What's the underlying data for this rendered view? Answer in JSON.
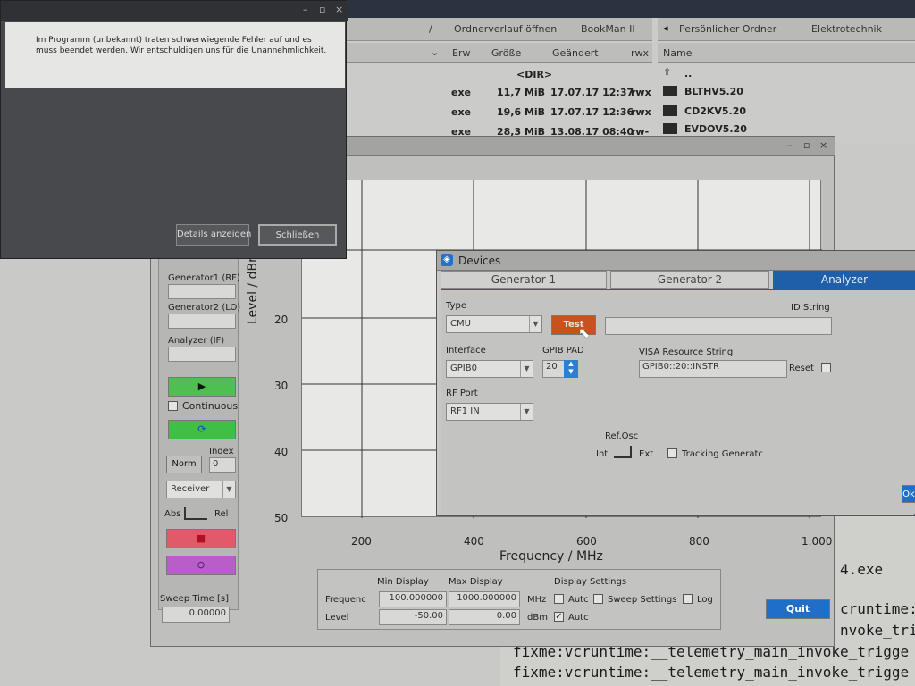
{
  "terminal": {
    "lines": [
      "4.exe",
      "cruntime:",
      "nvoke_trigge",
      "fixme:vcruntime:__telemetry_main_invoke_trigge",
      "fixme:vcruntime:__telemetry_main_invoke_trigge"
    ]
  },
  "file_manager": {
    "breadcrumb": [
      "Ordnerverlauf öffnen",
      "BookMan II"
    ],
    "right_breadcrumb": [
      "Persönlicher Ordner",
      "Elektrotechnik"
    ],
    "columns": [
      "Erw",
      "Größe",
      "Geändert",
      "rwx"
    ],
    "right_column": "Name",
    "rows": [
      {
        "ext": "",
        "size": "<DIR>",
        "date": "",
        "perm": ""
      },
      {
        "ext": "exe",
        "size": "11,7 MiB",
        "date": "17.07.17 12:37",
        "perm": "rwx"
      },
      {
        "ext": "exe",
        "size": "19,6 MiB",
        "date": "17.07.17 12:36",
        "perm": "rwx"
      },
      {
        "ext": "exe",
        "size": "28,3 MiB",
        "date": "13.08.17 08:40",
        "perm": "rw-"
      }
    ],
    "folders": [
      "..",
      "BLTHV5.20",
      "CD2KV5.20",
      "EVDOV5.20"
    ]
  },
  "error_dialog": {
    "message": "Im Programm (unbekannt) traten schwerwiegende Fehler auf und es muss beendet werden. Wir entschuldigen uns für die Unannehmlichkeit.",
    "details_button": "Details anzeigen",
    "close_button": "Schließen"
  },
  "main_app": {
    "left_panel": {
      "gen1_label": "Generator1 (RF)",
      "gen2_label": "Generator2 (LO)",
      "analyzer_label": "Analyzer (IF)",
      "continuous_label": "Continuous",
      "index_label": "Index",
      "index_value": "0",
      "norm_button": "Norm",
      "receiver_select": "Receiver",
      "abs_label": "Abs",
      "rel_label": "Rel",
      "sweep_time_label": "Sweep Time [s]",
      "sweep_time_value": "0.00000"
    },
    "display": {
      "min_label": "Min Display",
      "max_label": "Max Display",
      "settings_label": "Display Settings",
      "frequency_label": "Frequenc",
      "level_label": "Level",
      "freq_min": "100.000000",
      "freq_max": "1000.000000",
      "freq_unit": "MHz",
      "level_min": "-50.00",
      "level_max": "0.00",
      "level_unit": "dBm",
      "auto1": "Autc",
      "sweep_settings": "Sweep Settings",
      "log": "Log",
      "auto2": "Autc"
    },
    "quit_button": "Quit"
  },
  "chart_data": {
    "type": "line",
    "xlabel": "Frequency / MHz",
    "ylabel": "Level / dBm",
    "x_ticks": [
      "200",
      "400",
      "600",
      "800",
      "1.000"
    ],
    "y_ticks": [
      "20",
      "30",
      "40",
      "50"
    ],
    "xlim": [
      100,
      1000
    ],
    "grid": true,
    "series": []
  },
  "devices_dialog": {
    "title": "Devices",
    "tabs": [
      "Generator 1",
      "Generator 2",
      "Analyzer"
    ],
    "type_label": "Type",
    "type_value": "CMU",
    "test_button": "Test",
    "id_string_label": "ID String",
    "interface_label": "Interface",
    "interface_value": "GPIB0",
    "gpib_pad_label": "GPIB PAD",
    "gpib_pad_value": "20",
    "visa_label": "VISA Resource String",
    "visa_value": "GPIB0::20::INSTR",
    "reset_label": "Reset",
    "rf_port_label": "RF Port",
    "rf_port_value": "RF1 IN",
    "ref_osc_label": "Ref.Osc",
    "int_label": "Int",
    "ext_label": "Ext",
    "tracking_label": "Tracking Generatc",
    "ok_button": "Ok"
  },
  "colors": {
    "accent": "#1f5ea8",
    "test_button": "#c8521e",
    "run_green": "#4fbf52",
    "stop_red": "#e05a6a",
    "purple": "#b85ec8"
  }
}
